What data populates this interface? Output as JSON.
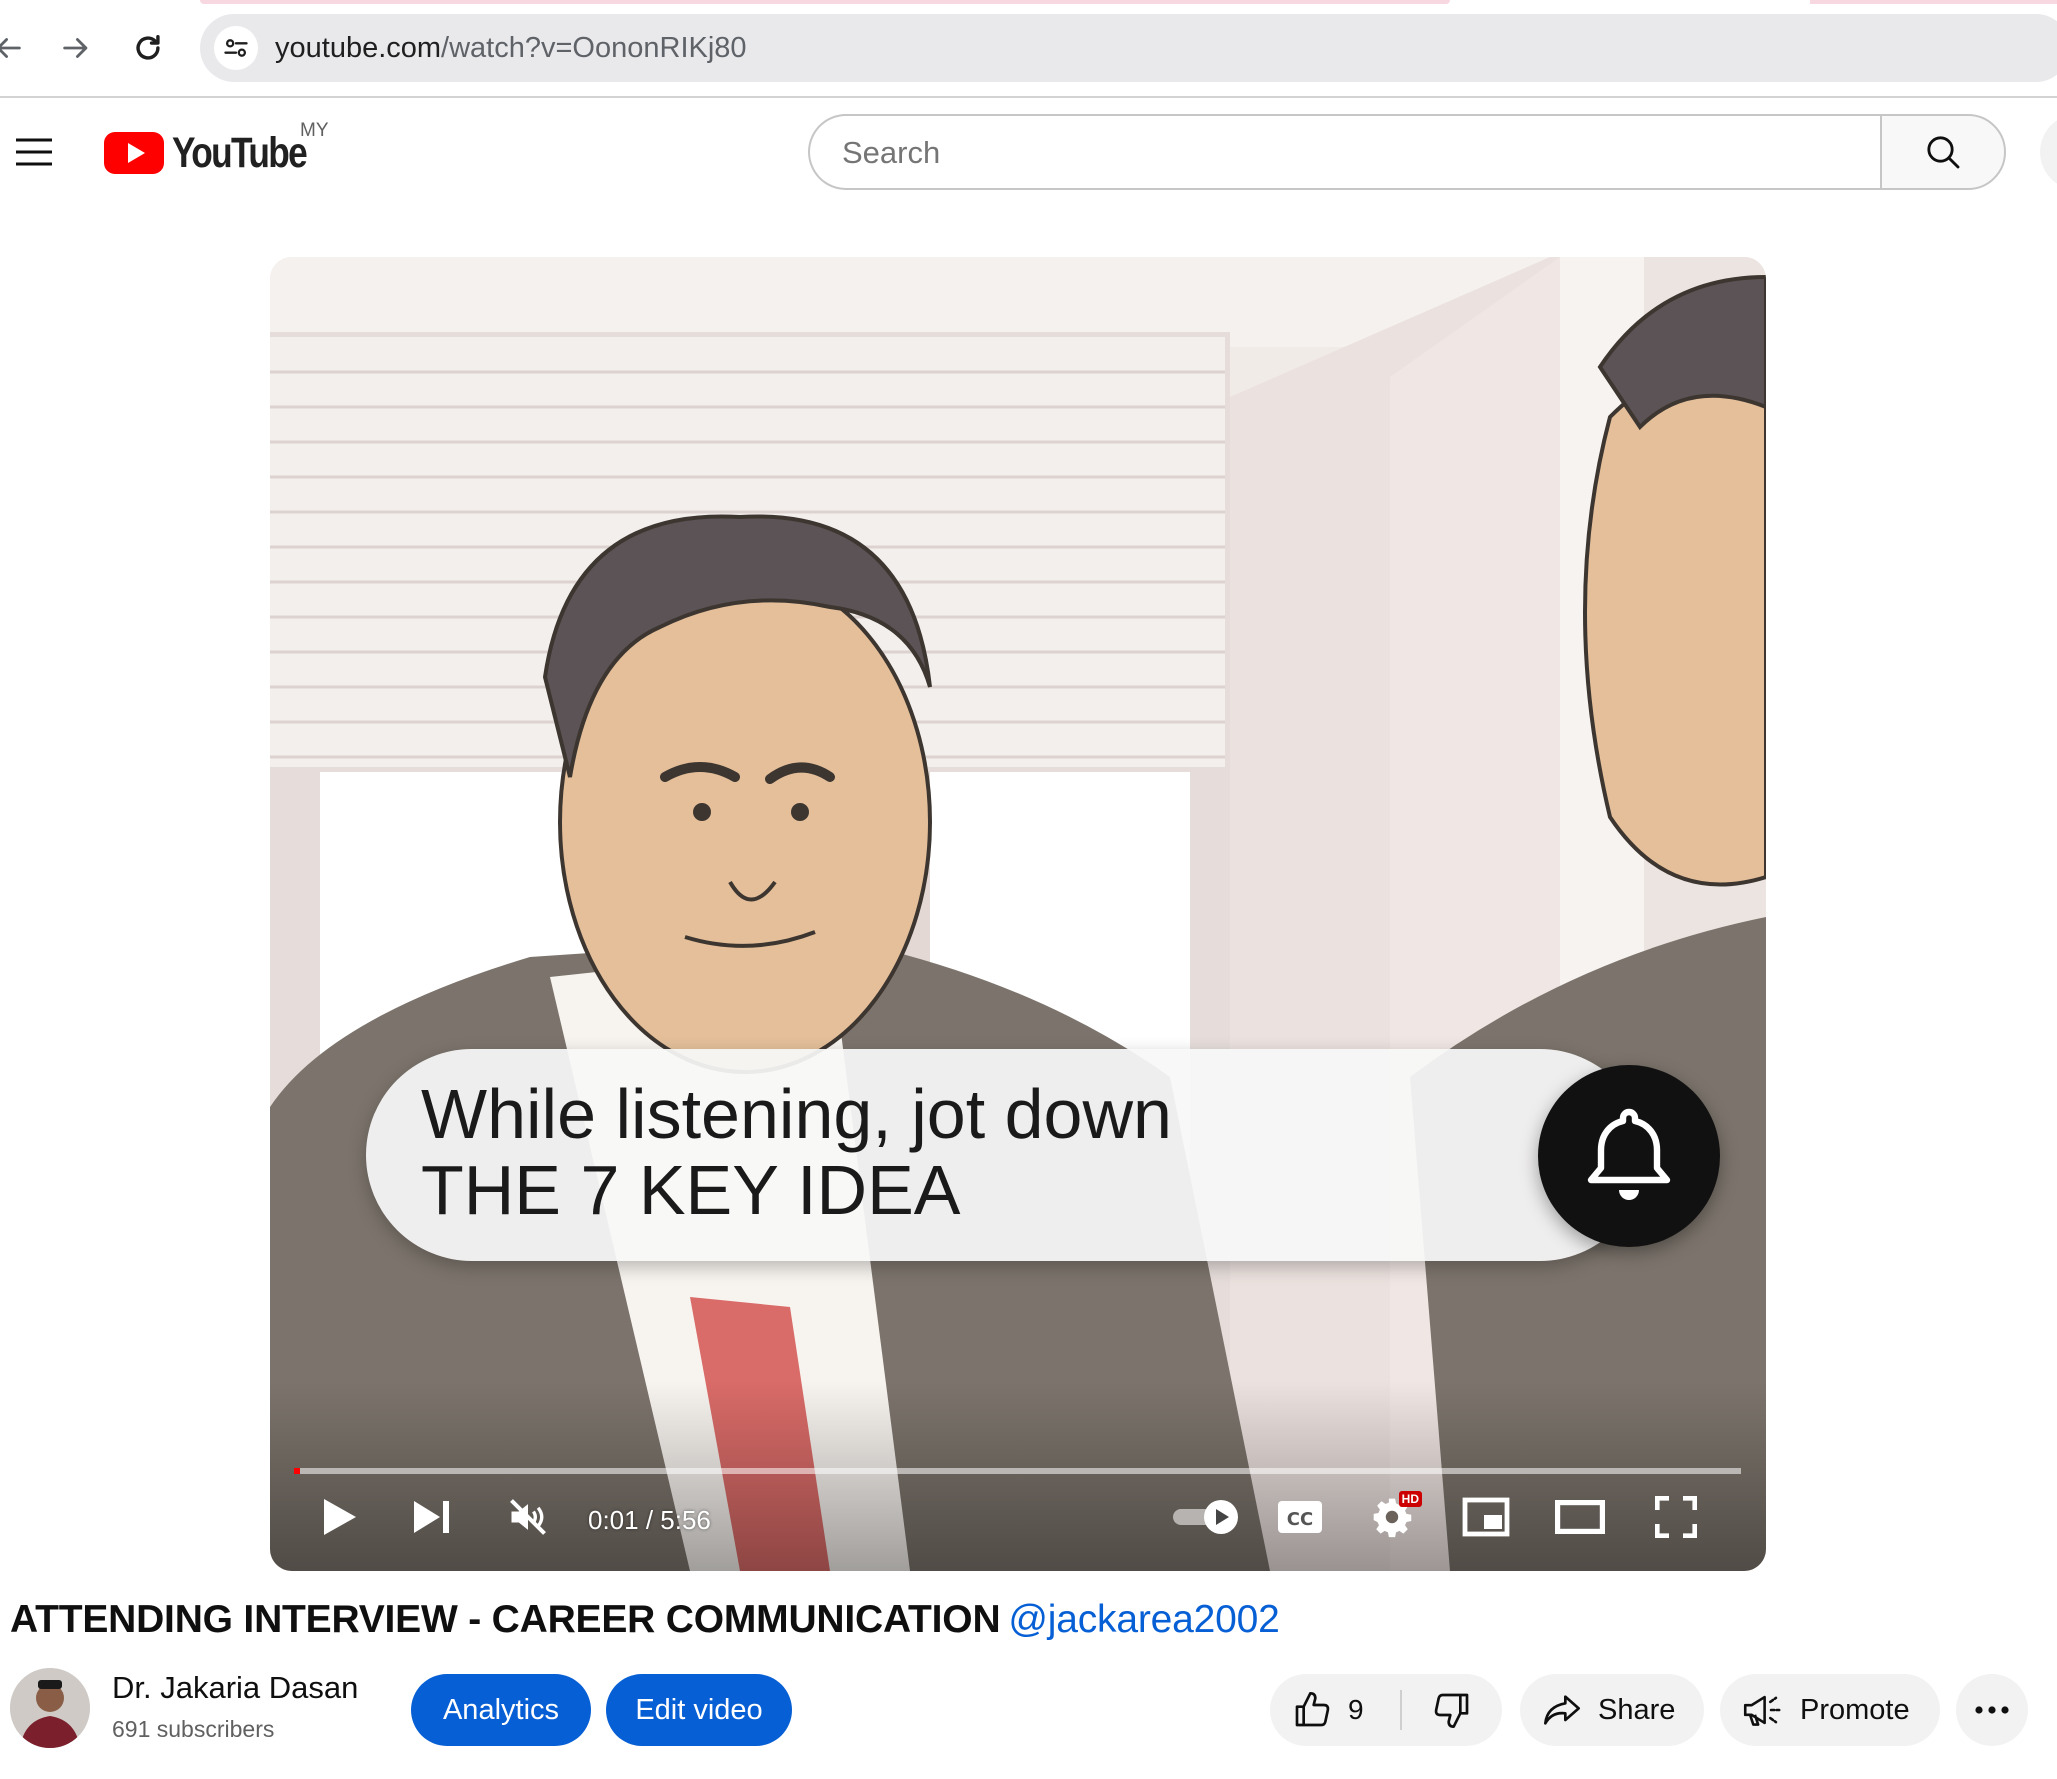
{
  "browser": {
    "url_host": "youtube.com",
    "url_path": "/watch?v=OononRIKj80",
    "icons": [
      "back-arrow-icon",
      "forward-arrow-icon",
      "reload-icon",
      "site-info-icon"
    ]
  },
  "masthead": {
    "logo_text": "YouTube",
    "region": "MY",
    "search_placeholder": "Search",
    "icons": [
      "hamburger-menu-icon",
      "youtube-logo-icon",
      "search-icon"
    ]
  },
  "player": {
    "caption_line1": "While listening, jot down",
    "caption_line2": "THE 7 KEY IDEA",
    "time_current": "0:01",
    "time_separator": " / ",
    "time_total": "5:56",
    "progress_fraction": 0.003,
    "hd_badge": "HD",
    "accent_color": "#ff0000",
    "icons": [
      "bell-icon",
      "play-icon",
      "next-icon",
      "muted-volume-icon",
      "autoplay-toggle-icon",
      "captions-icon",
      "settings-gear-icon",
      "miniplayer-icon",
      "theater-mode-icon",
      "fullscreen-icon"
    ]
  },
  "video": {
    "title": "ATTENDING INTERVIEW - CAREER COMMUNICATION",
    "title_handle": "@jackarea2002",
    "channel_name": "Dr. Jakaria Dasan",
    "subscribers": "691 subscribers"
  },
  "actions": {
    "analytics_label": "Analytics",
    "edit_label": "Edit video",
    "like_count": "9",
    "share_label": "Share",
    "promote_label": "Promote",
    "brand_blue": "#065fd4",
    "icons": [
      "thumbs-up-icon",
      "thumbs-down-icon",
      "share-arrow-icon",
      "promote-megaphone-icon",
      "more-options-icon"
    ]
  }
}
